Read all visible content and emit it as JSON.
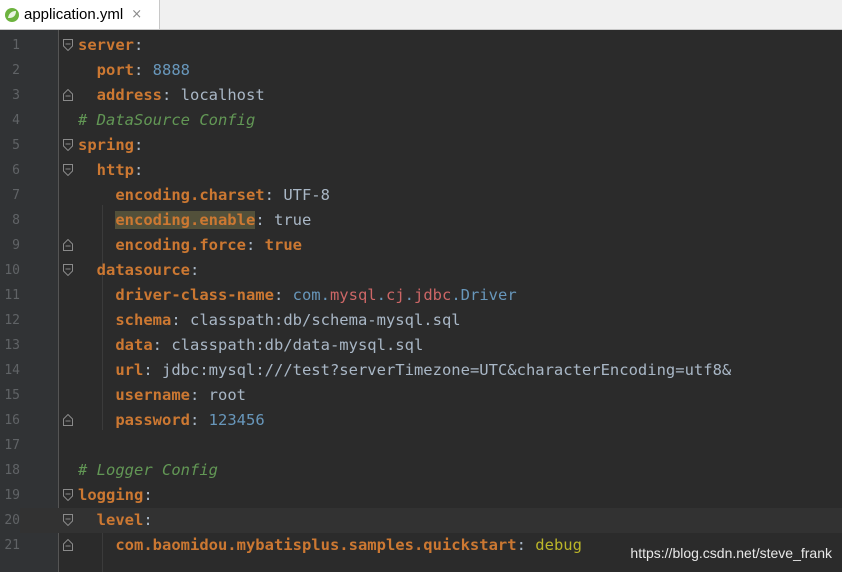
{
  "tab": {
    "filename": "application.yml",
    "close_glyph": "×",
    "icon": "spring-leaf-icon"
  },
  "line_numbers": [
    "1",
    "2",
    "3",
    "4",
    "5",
    "6",
    "7",
    "8",
    "9",
    "10",
    "11",
    "12",
    "13",
    "14",
    "15",
    "16",
    "17",
    "18",
    "19",
    "20",
    "21"
  ],
  "code": {
    "l1": {
      "key": "server",
      "colon": ":"
    },
    "l2": {
      "indent": "  ",
      "key": "port",
      "colon": ": ",
      "value": "8888"
    },
    "l3": {
      "indent": "  ",
      "key": "address",
      "colon": ": ",
      "value": "localhost"
    },
    "l4": {
      "indent": "",
      "comment": "# DataSource Config"
    },
    "l5": {
      "key": "spring",
      "colon": ":"
    },
    "l6": {
      "indent": "  ",
      "key": "http",
      "colon": ":"
    },
    "l7": {
      "indent": "    ",
      "key": "encoding.charset",
      "colon": ": ",
      "value": "UTF-8"
    },
    "l8": {
      "indent": "    ",
      "key": "encoding.enable",
      "colon": ": ",
      "value": "true"
    },
    "l9": {
      "indent": "    ",
      "key": "encoding.force",
      "colon": ": ",
      "value": "true"
    },
    "l10": {
      "indent": "  ",
      "key": "datasource",
      "colon": ":"
    },
    "l11": {
      "indent": "    ",
      "key": "driver-class-name",
      "colon": ": ",
      "v1": "com.",
      "v2": "mysql",
      "v3": ".",
      "v4": "cj",
      "v5": ".",
      "v6": "jdbc",
      "v7": ".Driver"
    },
    "l12": {
      "indent": "    ",
      "key": "schema",
      "colon": ": ",
      "value": "classpath:db/schema-mysql.sql"
    },
    "l13": {
      "indent": "    ",
      "key": "data",
      "colon": ": ",
      "value": "classpath:db/data-mysql.sql"
    },
    "l14": {
      "indent": "    ",
      "key": "url",
      "colon": ": ",
      "value": "jdbc:mysql:///test?serverTimezone=UTC&characterEncoding=utf8&"
    },
    "l15": {
      "indent": "    ",
      "key": "username",
      "colon": ": ",
      "value": "root"
    },
    "l16": {
      "indent": "    ",
      "key": "password",
      "colon": ": ",
      "value": "123456"
    },
    "l17": {
      "text": ""
    },
    "l18": {
      "indent": "",
      "comment": "# Logger Config"
    },
    "l19": {
      "key": "logging",
      "colon": ":"
    },
    "l20": {
      "indent": "  ",
      "key": "level",
      "colon": ":"
    },
    "l21": {
      "indent": "    ",
      "key": "com.baomidou.mybatisplus.samples.quickstart",
      "colon": ": ",
      "value": "debug"
    }
  },
  "watermark": "https://blog.csdn.net/steve_frank",
  "colors": {
    "background": "#2b2b2b",
    "gutter": "#313335",
    "key": "#cc7832",
    "number": "#6897bb",
    "comment": "#629755",
    "string": "#a9b7c6",
    "highlight": "#52503a"
  }
}
